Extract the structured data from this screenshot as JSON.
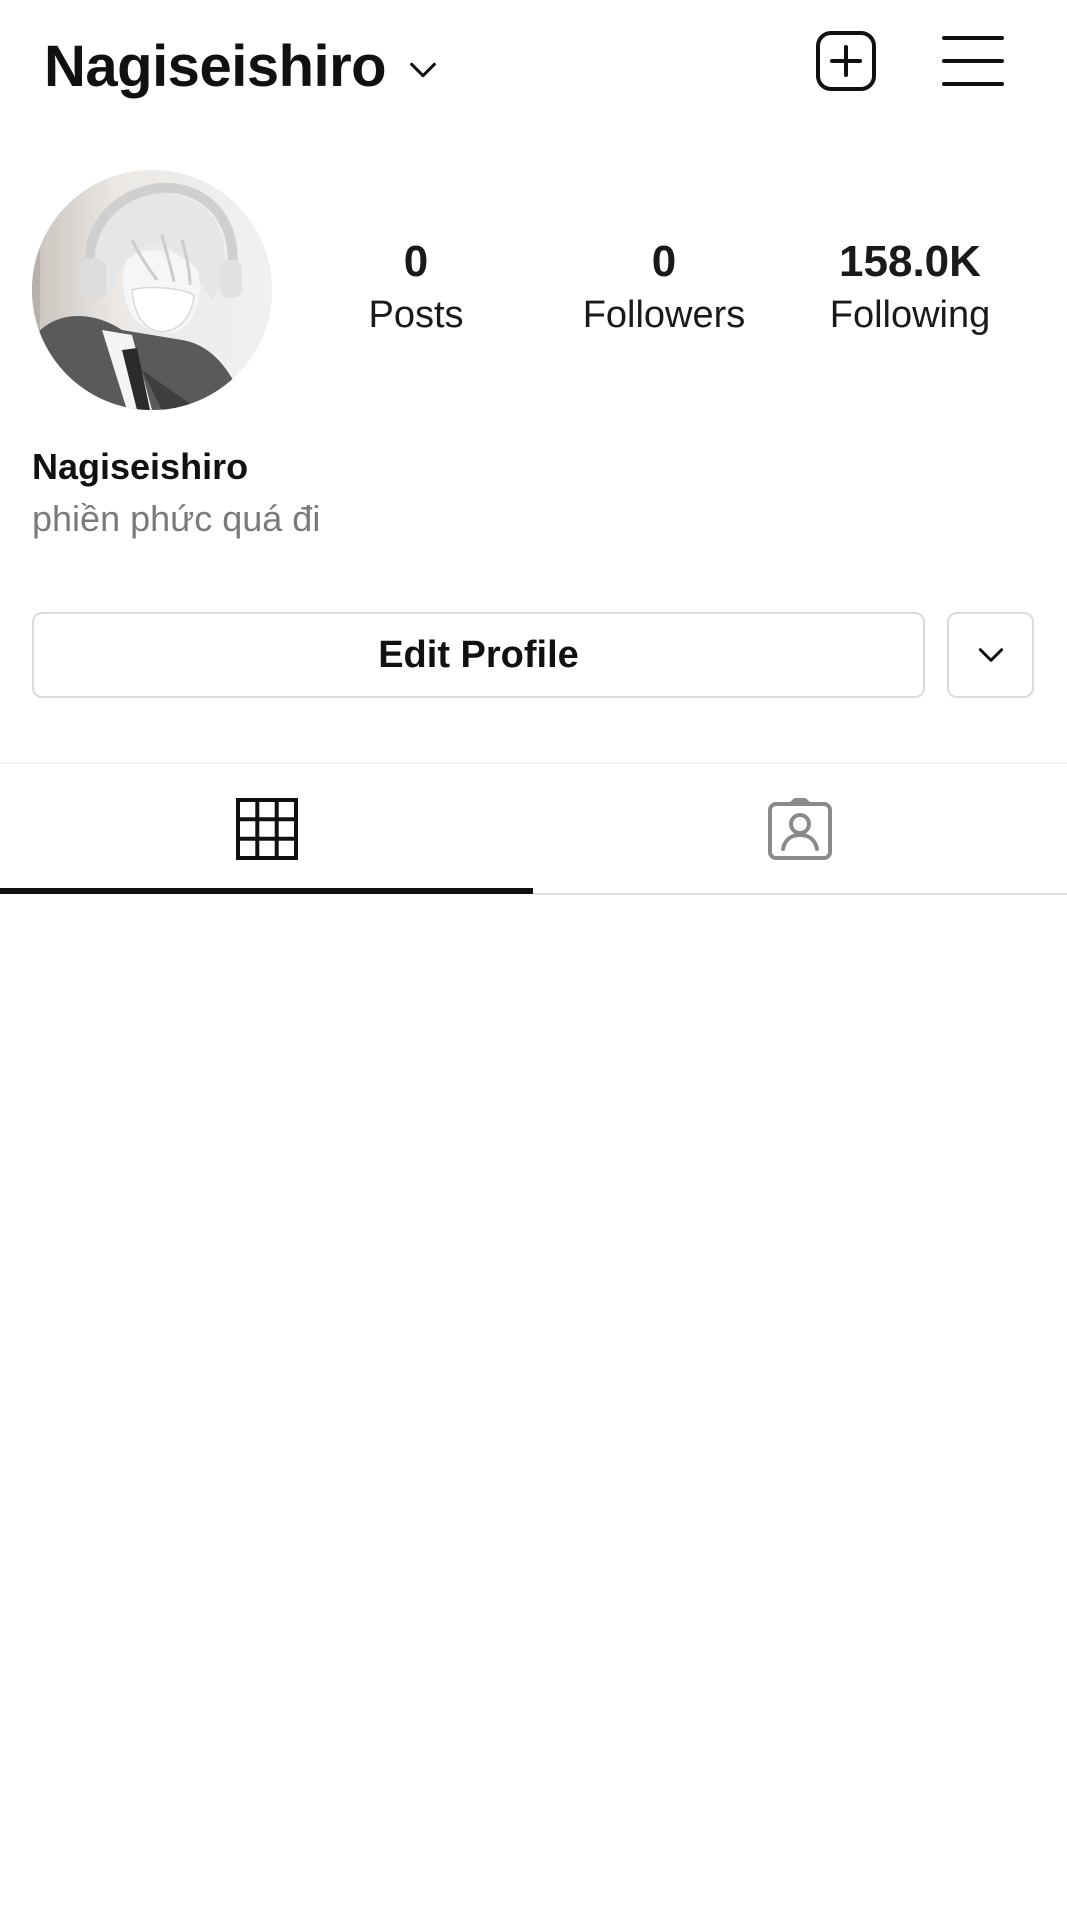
{
  "header": {
    "username": "Nagiseishiro",
    "icons": {
      "dropdown": "chevron-down-icon",
      "add_post": "plus-square-icon",
      "menu": "hamburger-menu-icon"
    }
  },
  "profile": {
    "avatar_icon": "profile-avatar",
    "stats": {
      "posts": {
        "value": "0",
        "label": "Posts"
      },
      "followers": {
        "value": "0",
        "label": "Followers"
      },
      "following": {
        "value": "158.0K",
        "label": "Following"
      }
    },
    "display_name": "Nagiseishiro",
    "bio": "phiền phức quá đi"
  },
  "actions": {
    "edit_profile_label": "Edit Profile",
    "more_icon": "chevron-down-icon"
  },
  "tabs": [
    {
      "name": "posts-grid",
      "icon": "grid-icon",
      "active": true
    },
    {
      "name": "tagged",
      "icon": "tagged-person-icon",
      "active": false
    }
  ],
  "colors": {
    "text_primary": "#111111",
    "text_secondary": "#7a7a7a",
    "border": "#dbdbdb",
    "active_tab": "#111111",
    "inactive_icon": "#8a8a8a"
  }
}
